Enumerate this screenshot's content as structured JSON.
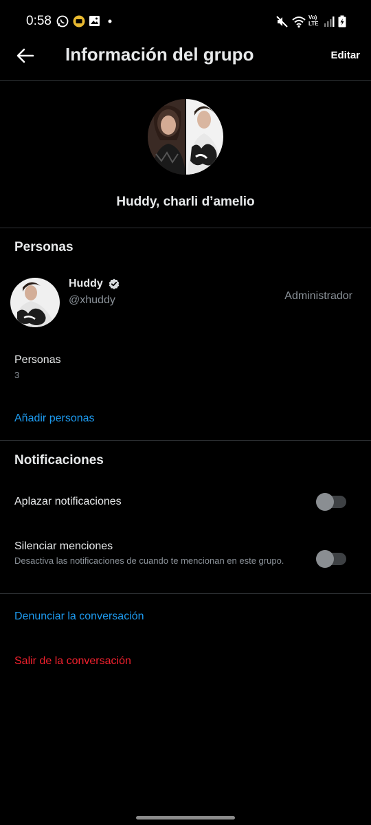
{
  "status_bar": {
    "time": "0:58",
    "icons_left": [
      "whatsapp-icon",
      "media-icon",
      "image-icon",
      "dot-icon"
    ],
    "icons_right": [
      "mute-icon",
      "wifi-icon",
      "volte-lte-icon",
      "signal-icon",
      "battery-icon"
    ],
    "volte_label": "Vo)",
    "lte_label": "LTE"
  },
  "header": {
    "title": "Información del grupo",
    "edit_label": "Editar"
  },
  "group": {
    "name": "Huddy, charli d’amelio"
  },
  "people_section": {
    "title": "Personas",
    "members": [
      {
        "name": "Huddy",
        "handle": "@xhuddy",
        "role": "Administrador",
        "verified": true
      }
    ],
    "count_label": "Personas",
    "count_value": "3",
    "add_people": "Añadir personas"
  },
  "notifications_section": {
    "title": "Notificaciones",
    "snooze_label": "Aplazar notificaciones",
    "snooze_on": false,
    "mute_mentions_label": "Silenciar menciones",
    "mute_mentions_desc": "Desactiva las notificaciones de cuando te mencionan en este grupo.",
    "mute_mentions_on": false
  },
  "actions": {
    "report": "Denunciar la conversación",
    "leave": "Salir de la conversación"
  },
  "colors": {
    "background": "#000000",
    "link": "#1d9bf0",
    "danger": "#f4212e",
    "divider": "#2f3336"
  }
}
